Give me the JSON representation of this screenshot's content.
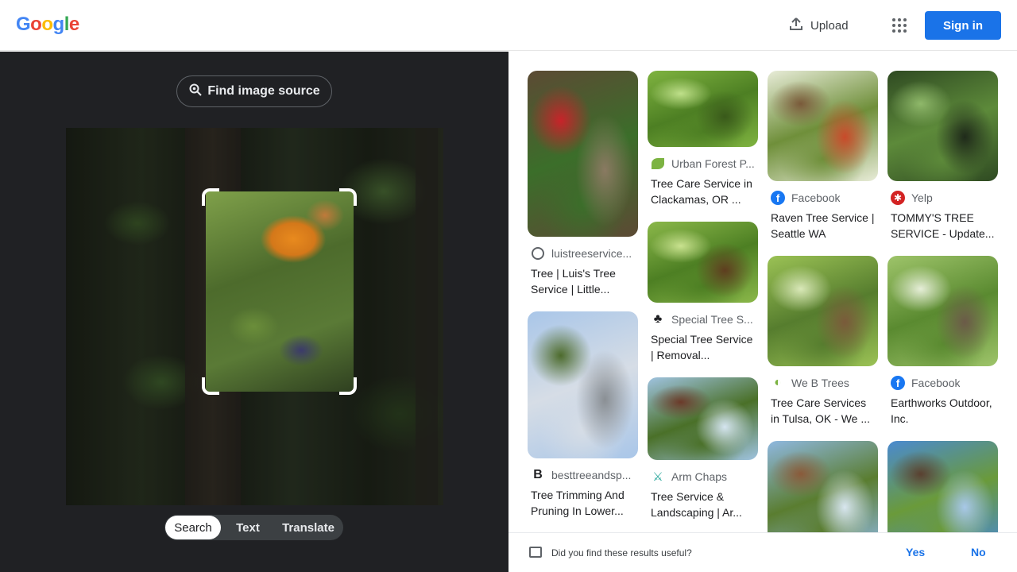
{
  "header": {
    "logo_letters": [
      "G",
      "o",
      "o",
      "g",
      "l",
      "e"
    ],
    "logo_colors": [
      "#4285F4",
      "#EA4335",
      "#FBBC05",
      "#4285F4",
      "#34A853",
      "#EA4335"
    ],
    "upload_label": "Upload",
    "signin_label": "Sign in",
    "apps_icon": "apps-grid-icon",
    "upload_icon": "upload-icon"
  },
  "left_panel": {
    "find_source_label": "Find image source",
    "find_source_icon": "lens-search-icon",
    "tabs": [
      {
        "label": "Search",
        "active": true
      },
      {
        "label": "Text",
        "active": false
      },
      {
        "label": "Translate",
        "active": false
      }
    ]
  },
  "results": {
    "columns": [
      [
        {
          "source": "luistreeservice...",
          "title": "Tree | Luis's Tree Service | Little...",
          "icon": "globe-icon",
          "thumb_height": 209,
          "palette": [
            "#5c4a34",
            "#3b6e2a",
            "#c8232a",
            "#8a7a62"
          ]
        },
        {
          "source": "besttreeandsp...",
          "title": "Tree Trimming And Pruning In Lower...",
          "icon": "b-logo-icon",
          "thumb_height": 185,
          "palette": [
            "#a9c6e8",
            "#d6dde6",
            "#4d6b2c",
            "#8a8f94"
          ]
        }
      ],
      [
        {
          "source": "Urban Forest P...",
          "title": "Tree Care Service in Clackamas, OR ...",
          "icon": "leaf-icon",
          "thumb_height": 96,
          "palette": [
            "#7fb340",
            "#4d7f23",
            "#bfe08a",
            "#39591a"
          ]
        },
        {
          "source": "Special Tree S...",
          "title": "Special Tree Service | Removal...",
          "icon": "tree-icon",
          "thumb_height": 102,
          "palette": [
            "#8bb84a",
            "#4d7f23",
            "#c9e28f",
            "#5e3d1f"
          ]
        },
        {
          "source": "Arm Chaps",
          "title": "Tree Service & Landscaping | Ar...",
          "icon": "arm-chaps-icon",
          "thumb_height": 104,
          "palette": [
            "#9fc3e0",
            "#4a7028",
            "#6b3a2a",
            "#d5e5f0"
          ]
        }
      ],
      [
        {
          "source": "Facebook",
          "title": "Raven Tree Service | Seattle WA",
          "icon": "facebook-icon",
          "thumb_height": 139,
          "palette": [
            "#e8ecd8",
            "#6f8f3a",
            "#7a5a3a",
            "#c94a2a"
          ]
        },
        {
          "source": "We B Trees",
          "title": "Tree Care Services in Tulsa, OK - We ...",
          "icon": "leaf-ring-icon",
          "thumb_height": 139,
          "palette": [
            "#9bc255",
            "#567d2e",
            "#d9e8b8",
            "#7a5a3a"
          ]
        },
        {
          "source": "",
          "title": "",
          "icon": "",
          "thumb_height": 139,
          "palette": [
            "#8fb8e0",
            "#5a7d30",
            "#8a5a3a",
            "#d8e6ef"
          ]
        }
      ],
      [
        {
          "source": "Yelp",
          "title": "TOMMY'S TREE SERVICE - Update...",
          "icon": "yelp-icon",
          "thumb_height": 139,
          "palette": [
            "#2f4a22",
            "#5d8a3a",
            "#8fb86a",
            "#1f2a1a"
          ]
        },
        {
          "source": "Facebook",
          "title": "Earthworks Outdoor, Inc.",
          "icon": "facebook-icon",
          "thumb_height": 139,
          "palette": [
            "#9ec46a",
            "#5a8a30",
            "#e6eed8",
            "#6b5a48"
          ]
        },
        {
          "source": "",
          "title": "",
          "icon": "",
          "thumb_height": 139,
          "palette": [
            "#4a8ad0",
            "#6a9a3a",
            "#5a4030",
            "#a8c8e8"
          ]
        }
      ]
    ]
  },
  "feedback": {
    "question": "Did you find these results useful?",
    "yes_label": "Yes",
    "no_label": "No",
    "icon": "feedback-icon"
  }
}
